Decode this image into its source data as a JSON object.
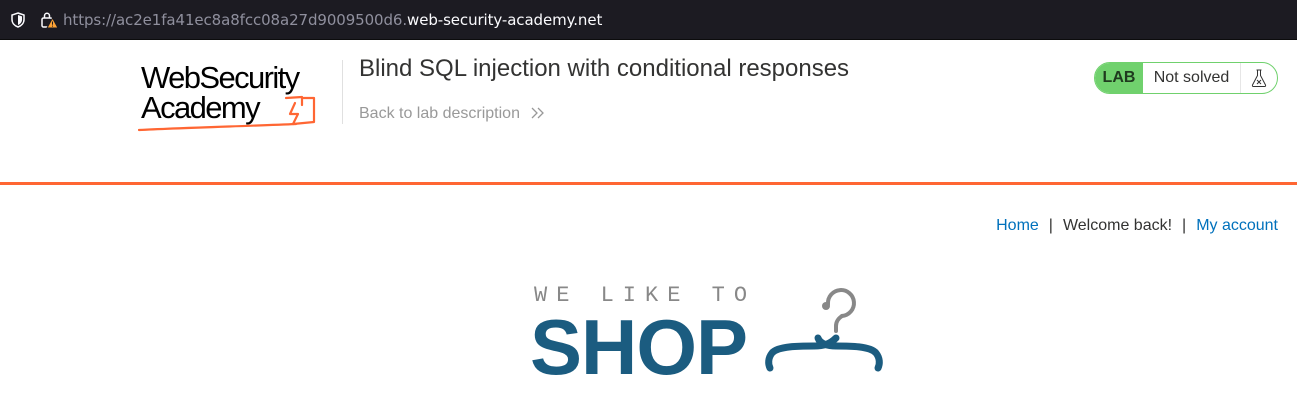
{
  "browser": {
    "url_prefix": "https://ac2e1fa41ec8a8fcc08a27d9009500d6.",
    "url_host": "web-security-academy.net"
  },
  "lab_header": {
    "logo_line1": "WebSecurity",
    "logo_line2": "Academy",
    "title": "Blind SQL injection with conditional responses",
    "back_link": "Back to lab description",
    "lab_tag": "LAB",
    "status": "Not solved"
  },
  "nav": {
    "home": "Home",
    "separator": "|",
    "welcome": "Welcome back!",
    "my_account": "My account"
  },
  "shop_logo": {
    "tagline": "WE LIKE TO",
    "word": "SHOP"
  },
  "colors": {
    "accent_orange": "#ff6633",
    "lab_green": "#70d16d",
    "link_blue": "#0071bc",
    "shop_blue": "#1b5c80"
  },
  "icons": [
    "shield-icon",
    "lock-warning-icon",
    "double-chevron-right-icon",
    "flask-icon",
    "hanger-icon"
  ]
}
